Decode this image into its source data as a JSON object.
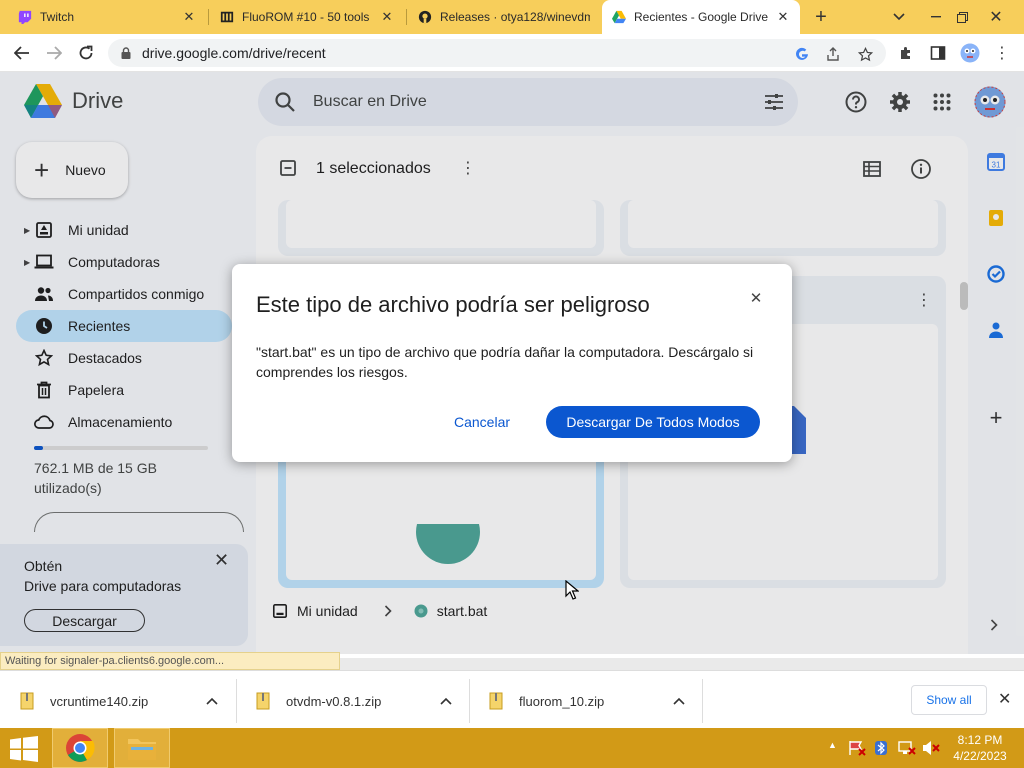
{
  "browser": {
    "tabs": [
      {
        "title": "Twitch",
        "icon": "twitch-icon",
        "active": false
      },
      {
        "title": "FluoROM #10 - 50 tools",
        "icon": "fluorom-icon",
        "active": false
      },
      {
        "title": "Releases · otya128/winevdm",
        "icon": "github-icon",
        "active": false
      },
      {
        "title": "Recientes - Google Drive",
        "icon": "drive-icon",
        "active": true
      }
    ],
    "url": "drive.google.com/drive/recent"
  },
  "drive": {
    "product": "Drive",
    "search_placeholder": "Buscar en Drive",
    "new_label": "Nuevo",
    "sidebar": [
      {
        "label": "Mi unidad",
        "icon": "my-drive-icon",
        "caret": true,
        "active": false
      },
      {
        "label": "Computadoras",
        "icon": "computer-icon",
        "caret": true,
        "active": false
      },
      {
        "label": "Compartidos conmigo",
        "icon": "shared-icon",
        "caret": false,
        "active": false
      },
      {
        "label": "Recientes",
        "icon": "clock-icon",
        "caret": false,
        "active": true
      },
      {
        "label": "Destacados",
        "icon": "star-icon",
        "caret": false,
        "active": false
      },
      {
        "label": "Papelera",
        "icon": "trash-icon",
        "caret": false,
        "active": false
      },
      {
        "label": "Almacenamiento",
        "icon": "cloud-icon",
        "caret": false,
        "active": false
      }
    ],
    "storage": {
      "text": "762.1 MB de 15 GB utilizado(s)",
      "used_fraction": 0.05
    },
    "promo": {
      "line1": "Obtén",
      "line2": "Drive para computadoras",
      "button": "Descargar"
    },
    "selection": {
      "count_label": "1 seleccionados"
    },
    "breadcrumb": {
      "root": "Mi unidad",
      "file": "start.bat"
    }
  },
  "dialog": {
    "title": "Este tipo de archivo podría ser peligroso",
    "body": "\"start.bat\" es un tipo de archivo que podría dañar la computadora. Descárgalo si comprendes los riesgos.",
    "cancel": "Cancelar",
    "confirm": "Descargar De Todos Modos"
  },
  "status_text": "Waiting for signaler-pa.clients6.google.com...",
  "downloads": {
    "items": [
      "vcruntime140.zip",
      "otvdm-v0.8.1.zip",
      "fluorom_10.zip"
    ],
    "show_all": "Show all"
  },
  "taskbar": {
    "time": "8:12 PM",
    "date": "4/22/2023"
  },
  "colors": {
    "accent": "#0b57d0",
    "active_nav": "#c2e7ff",
    "tabstrip": "#f7ce5b",
    "taskbar": "#d29a17"
  }
}
